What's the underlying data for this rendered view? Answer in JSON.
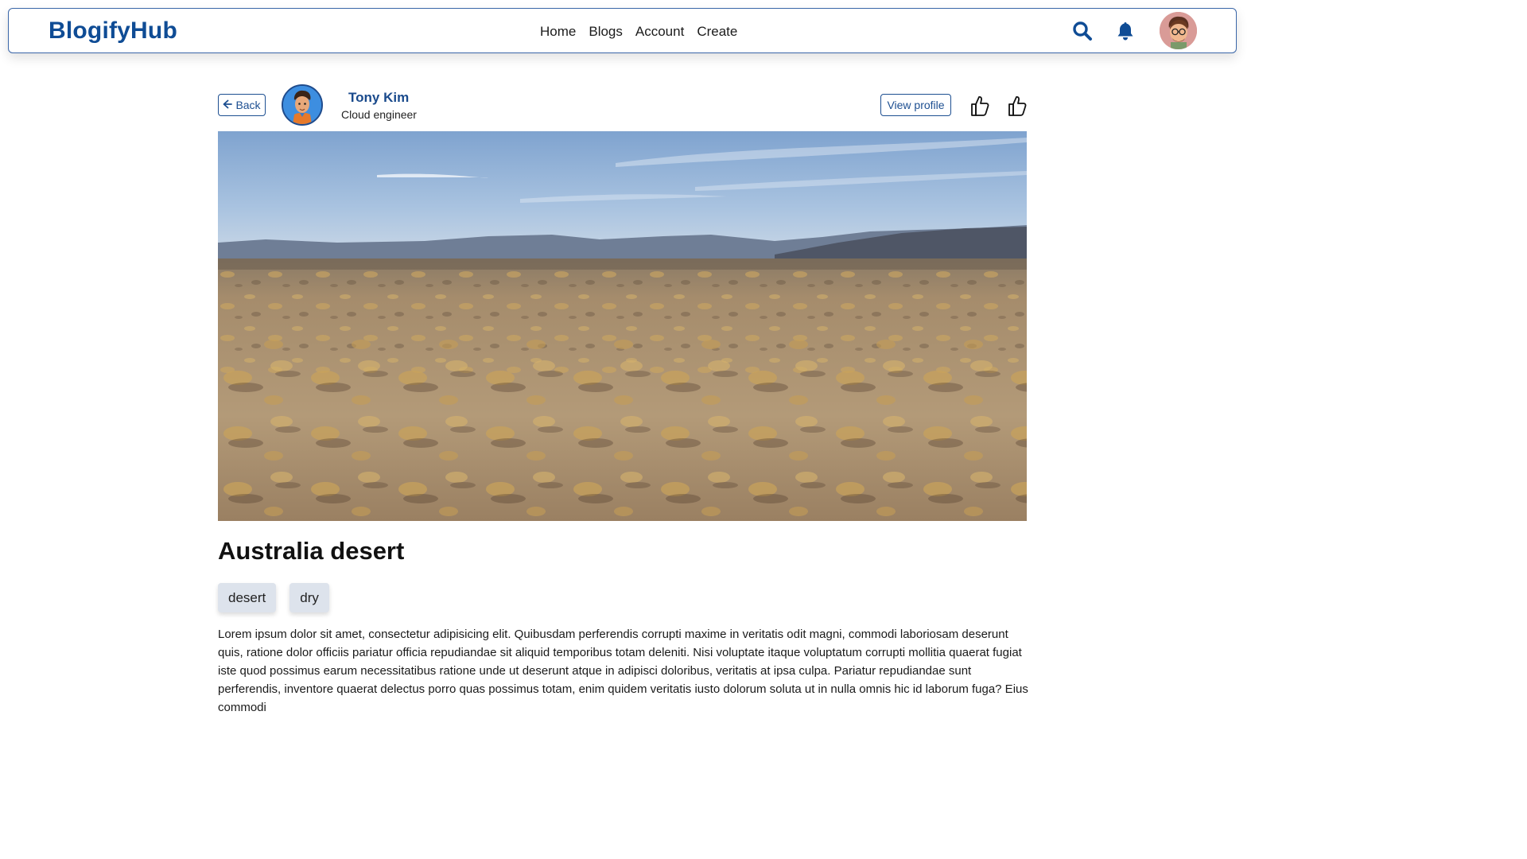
{
  "nav": {
    "brand": "BlogifyHub",
    "links": [
      "Home",
      "Blogs",
      "Account",
      "Create"
    ],
    "icons": [
      "search-icon",
      "bell-icon",
      "avatar"
    ]
  },
  "post": {
    "back_label": "Back",
    "author_name": "Tony Kim",
    "author_role": "Cloud engineer",
    "view_profile_label": "View profile",
    "title": "Australia desert",
    "tags": [
      "desert",
      "dry"
    ],
    "body": "Lorem ipsum dolor sit amet, consectetur adipisicing elit. Quibusdam perferendis corrupti maxime in veritatis odit magni, commodi laboriosam deserunt quis, ratione dolor officiis pariatur officia repudiandae sit aliquid temporibus totam deleniti. Nisi voluptate itaque voluptatum corrupti mollitia quaerat fugiat iste quod possimus earum necessitatibus ratione unde ut deserunt atque in adipisci doloribus, veritatis at ipsa culpa. Pariatur repudiandae sunt perferendis, inventore quaerat delectus porro quas possimus totam, enim quidem veritatis iusto dolorum soluta ut in nulla omnis hic id laborum fuga? Eius commodi"
  },
  "colors": {
    "brand": "#0f4c95",
    "accent": "#1d4f91",
    "tag_bg": "#dde3ec"
  }
}
